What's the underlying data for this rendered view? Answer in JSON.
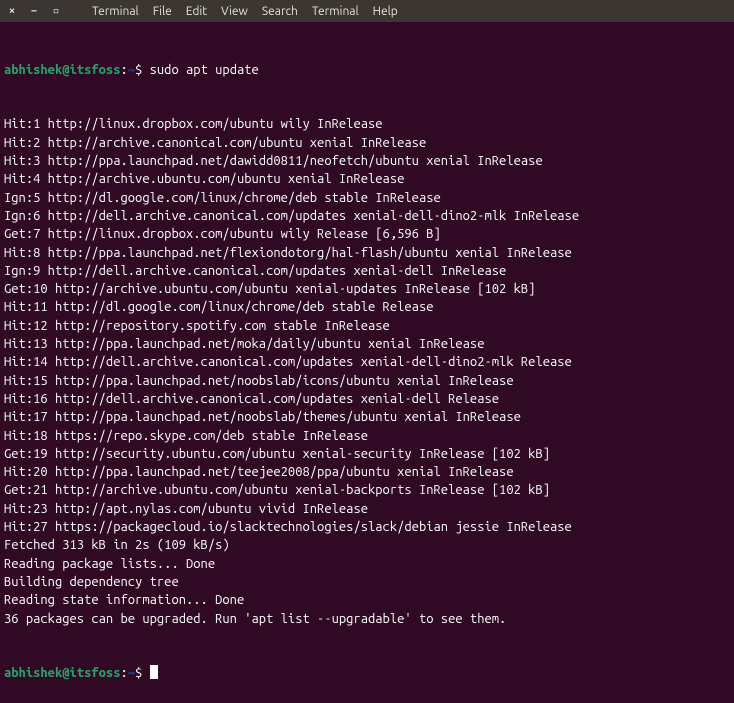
{
  "window": {
    "menu": [
      "Terminal",
      "File",
      "Edit",
      "View",
      "Search",
      "Terminal",
      "Help"
    ]
  },
  "prompt": {
    "user_host": "abhishek@itsfoss",
    "colon": ":",
    "path": "~",
    "dollar": "$"
  },
  "command": "sudo apt update",
  "output": [
    "Hit:1 http://linux.dropbox.com/ubuntu wily InRelease",
    "Hit:2 http://archive.canonical.com/ubuntu xenial InRelease",
    "Hit:3 http://ppa.launchpad.net/dawidd0811/neofetch/ubuntu xenial InRelease",
    "Hit:4 http://archive.ubuntu.com/ubuntu xenial InRelease",
    "Ign:5 http://dl.google.com/linux/chrome/deb stable InRelease",
    "Ign:6 http://dell.archive.canonical.com/updates xenial-dell-dino2-mlk InRelease",
    "Get:7 http://linux.dropbox.com/ubuntu wily Release [6,596 B]",
    "Hit:8 http://ppa.launchpad.net/flexiondotorg/hal-flash/ubuntu xenial InRelease",
    "Ign:9 http://dell.archive.canonical.com/updates xenial-dell InRelease",
    "Get:10 http://archive.ubuntu.com/ubuntu xenial-updates InRelease [102 kB]",
    "Hit:11 http://dl.google.com/linux/chrome/deb stable Release",
    "Hit:12 http://repository.spotify.com stable InRelease",
    "Hit:13 http://ppa.launchpad.net/moka/daily/ubuntu xenial InRelease",
    "Hit:14 http://dell.archive.canonical.com/updates xenial-dell-dino2-mlk Release",
    "Hit:15 http://ppa.launchpad.net/noobslab/icons/ubuntu xenial InRelease",
    "Hit:16 http://dell.archive.canonical.com/updates xenial-dell Release",
    "Hit:17 http://ppa.launchpad.net/noobslab/themes/ubuntu xenial InRelease",
    "Hit:18 https://repo.skype.com/deb stable InRelease",
    "Get:19 http://security.ubuntu.com/ubuntu xenial-security InRelease [102 kB]",
    "Hit:20 http://ppa.launchpad.net/teejee2008/ppa/ubuntu xenial InRelease",
    "Get:21 http://archive.ubuntu.com/ubuntu xenial-backports InRelease [102 kB]",
    "Hit:23 http://apt.nylas.com/ubuntu vivid InRelease",
    "Hit:27 https://packagecloud.io/slacktechnologies/slack/debian jessie InRelease",
    "Fetched 313 kB in 2s (109 kB/s)",
    "Reading package lists... Done",
    "Building dependency tree",
    "Reading state information... Done",
    "36 packages can be upgraded. Run 'apt list --upgradable' to see them."
  ]
}
